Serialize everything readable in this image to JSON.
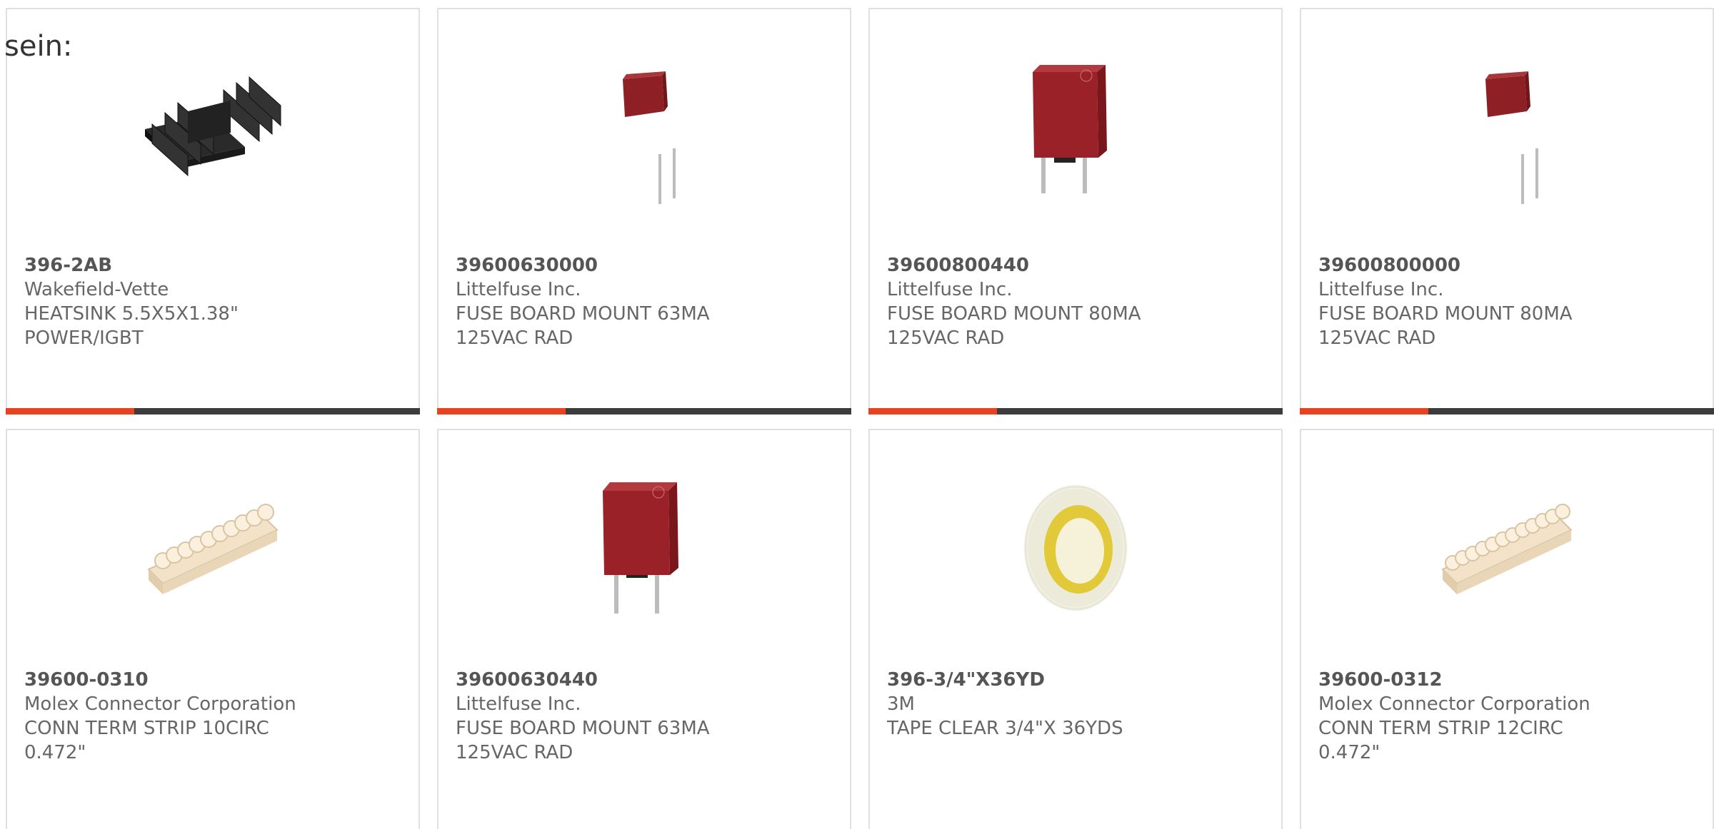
{
  "prefix_text": "sein:",
  "accent_color": "#e8421e",
  "bar_track_color": "#3c3c3c",
  "products": [
    {
      "part_number": "396-2AB",
      "manufacturer": "Wakefield-Vette",
      "description": "HEATSINK 5.5X5X1.38\"\nPOWER/IGBT",
      "image_icon": "heatsink-image",
      "bar_progress": 0.31
    },
    {
      "part_number": "39600630000",
      "manufacturer": "Littelfuse Inc.",
      "description": "FUSE BOARD MOUNT 63MA\n125VAC RAD",
      "image_icon": "fuse-small-image",
      "bar_progress": 0.31
    },
    {
      "part_number": "39600800440",
      "manufacturer": "Littelfuse Inc.",
      "description": "FUSE BOARD MOUNT 80MA\n125VAC RAD",
      "image_icon": "fuse-large-image",
      "bar_progress": 0.31
    },
    {
      "part_number": "39600800000",
      "manufacturer": "Littelfuse Inc.",
      "description": "FUSE BOARD MOUNT 80MA\n125VAC RAD",
      "image_icon": "fuse-small-image",
      "bar_progress": 0.31
    },
    {
      "part_number": "39600-0310",
      "manufacturer": "Molex Connector Corporation",
      "description": "CONN TERM STRIP 10CIRC\n0.472\"",
      "image_icon": "terminal-strip-image"
    },
    {
      "part_number": "39600630440",
      "manufacturer": "Littelfuse Inc.",
      "description": "FUSE BOARD MOUNT 63MA\n125VAC RAD",
      "image_icon": "fuse-large-image"
    },
    {
      "part_number": "396-3/4\"X36YD",
      "manufacturer": "3M",
      "description": "TAPE CLEAR 3/4\"X 36YDS",
      "image_icon": "tape-roll-image"
    },
    {
      "part_number": "39600-0312",
      "manufacturer": "Molex Connector Corporation",
      "description": "CONN TERM STRIP 12CIRC\n0.472\"",
      "image_icon": "terminal-strip-image"
    }
  ]
}
